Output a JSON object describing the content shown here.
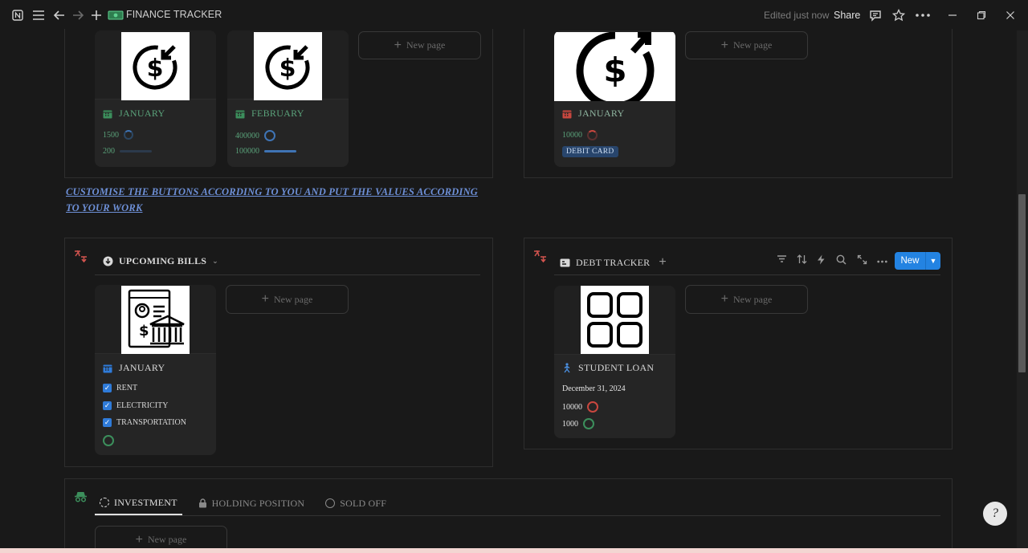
{
  "topbar": {
    "title": "FINANCE TRACKER",
    "edited": "Edited just now",
    "share": "Share"
  },
  "income": {
    "cards": [
      {
        "title": "JANUARY",
        "value1": "1500",
        "value2": "200"
      },
      {
        "title": "FEBRUARY",
        "value1": "400000",
        "value2": "100000"
      }
    ],
    "new_page": "New page"
  },
  "expenses": {
    "cards": [
      {
        "title": "JANUARY",
        "value1": "10000",
        "tag": "DEBIT CARD"
      }
    ],
    "new_page": "New page"
  },
  "note": "CUSTOMISE THE BUTTONS ACCORDING TO YOU AND PUT THE VALUES ACCORDING TO YOUR WORK",
  "bills": {
    "header": "UPCOMING BILLS",
    "card": {
      "title": "JANUARY",
      "items": [
        "RENT",
        "ELECTRICITY",
        "TRANSPORTATION"
      ]
    },
    "new_page": "New page"
  },
  "debt": {
    "header": "DEBT TRACKER",
    "new_button": "New",
    "card": {
      "title": "STUDENT LOAN",
      "date": "December 31, 2024",
      "value1": "10000",
      "value2": "1000"
    },
    "new_page": "New page"
  },
  "investment": {
    "tabs": [
      "INVESTMENT",
      "HOLDING POSITION",
      "SOLD OFF"
    ],
    "new_page": "New page"
  },
  "colors": {
    "accent_blue": "#2383e2",
    "green_text": "#5aa27a",
    "red_icon": "#d3544f",
    "note_blue": "#6d8fd6"
  }
}
